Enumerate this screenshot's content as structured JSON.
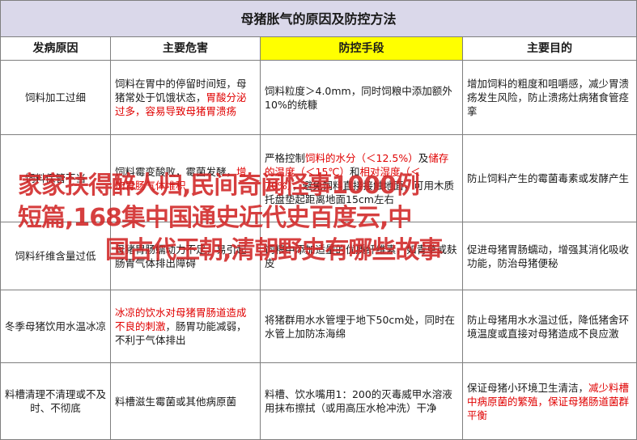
{
  "title": "母猪胀气的原因及防控方法",
  "headers": [
    "发病原因",
    "主要危害",
    "防控手段",
    "主要目的"
  ],
  "rows": [
    {
      "cause": "饲料加工过细",
      "harm": [
        {
          "t": "饲料在胃中的停留时间短，母猪常处于饥饿状态，"
        },
        {
          "t": "胃酸分泌过多，容易导致母猪胃溃疡",
          "r": true
        }
      ],
      "control": [
        {
          "t": "饲料粒度＞4.0mm，同时饲粮中添加额外10%的统糠"
        }
      ],
      "purpose": [
        {
          "t": "增加饲料的粗度和咀嚼感，减少胃溃疡发生风险，防止溃疡灶病猪食管痉挛"
        }
      ]
    },
    {
      "cause": "饲料保管不当",
      "harm": [
        {
          "t": "饲料霉变酸败，霉菌发酵，"
        },
        {
          "t": "增加胃肠气体堆积",
          "r": true
        }
      ],
      "control": [
        {
          "t": "严格控制"
        },
        {
          "t": "饲料的水分（＜12.5%）",
          "r": true
        },
        {
          "t": "及"
        },
        {
          "t": "储存的温度（＜15℃）",
          "r": true
        },
        {
          "t": "和"
        },
        {
          "t": "相对湿度（＜70%）",
          "r": true
        },
        {
          "t": "，避免饲料直接接触地面，可用木质托盘垫起距离地面15cm左右"
        }
      ],
      "purpose": [
        {
          "t": "防止饲料产生的霉菌毒素或发酵产生"
        }
      ]
    },
    {
      "cause": "饲料纤维含量过低",
      "harm": [
        {
          "t": "母猪胃肠蠕动力不足，易引起肠胃气体排出障碍"
        }
      ],
      "control": [
        {
          "t": "饲粮中添加适量的优质纤维素，如青草或麸皮"
        }
      ],
      "purpose": [
        {
          "t": "促进母猪胃肠蠕动，增强其消化吸收功能，防治母猪便秘"
        }
      ]
    },
    {
      "cause": "冬季母猪饮用水温冰凉",
      "harm": [
        {
          "t": "冰凉的饮水对母猪胃肠道造成不良的刺激",
          "r": true
        },
        {
          "t": "，肠胃功能减弱，不利于气体排出"
        }
      ],
      "control": [
        {
          "t": "将猪群用水水管埋于地下50cm处，同时在水管上加防冻海绵"
        }
      ],
      "purpose": [
        {
          "t": "防止母猪用水水温过低，降低猪舍环境温度或直接对母猪造成不良应激"
        }
      ]
    },
    {
      "cause": "料槽清理不清理或不及时、不彻底",
      "harm": [
        {
          "t": "料槽滋生霉菌或其他病原菌"
        }
      ],
      "control": [
        {
          "t": "料槽、饮水嘴用1：200的灭毒威甲水溶液用抹布擦拭（或用高压水枪冲洗）干净"
        }
      ],
      "purpose": [
        {
          "t": "保证母猪小环境卫生清洁，"
        },
        {
          "t": "减少料槽中病原菌的繁殖，保证母猪肠道菌群平衡",
          "r": true
        }
      ]
    }
  ],
  "watermark": [
    "家家扶得醉人归,民间奇闻怪事1000例",
    "短篇,168集中国通史近代史百度云,中",
    "国古代王朝,清朝野史有哪些故事"
  ],
  "colors": {
    "title_bg": "#dad8ea",
    "highlight": "#ffff00",
    "emphasis": "#e00000"
  }
}
